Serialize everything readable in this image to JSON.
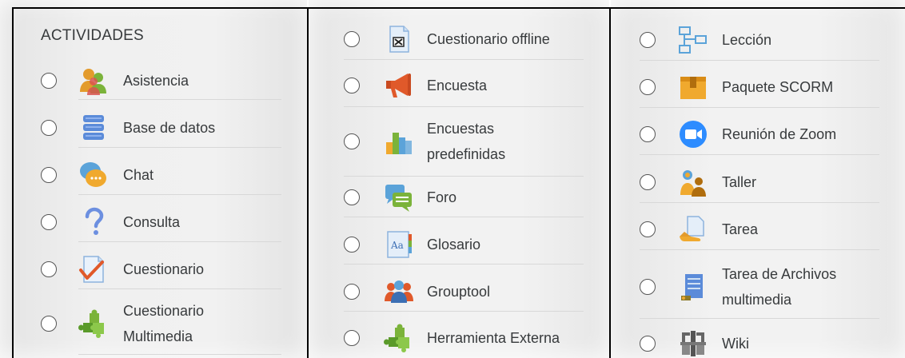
{
  "heading": "ACTIVIDADES",
  "columns": [
    {
      "items": [
        {
          "label": "Asistencia",
          "icon": "attendance-icon"
        },
        {
          "label": "Base de datos",
          "icon": "database-icon"
        },
        {
          "label": "Chat",
          "icon": "chat-icon"
        },
        {
          "label": "Consulta",
          "icon": "question-icon"
        },
        {
          "label": "Cuestionario",
          "icon": "quiz-icon"
        },
        {
          "label": "Cuestionario\nMultimedia",
          "icon": "puzzle-icon"
        }
      ]
    },
    {
      "items": [
        {
          "label": "Cuestionario offline",
          "icon": "offline-quiz-icon"
        },
        {
          "label": "Encuesta",
          "icon": "megaphone-icon"
        },
        {
          "label": "Encuestas\npredefinidas",
          "icon": "bar-chart-icon"
        },
        {
          "label": "Foro",
          "icon": "forum-icon"
        },
        {
          "label": "Glosario",
          "icon": "glossary-icon"
        },
        {
          "label": "Grouptool",
          "icon": "group-icon"
        },
        {
          "label": "Herramienta Externa",
          "icon": "puzzle-icon"
        }
      ]
    },
    {
      "items": [
        {
          "label": "Lección",
          "icon": "lesson-icon"
        },
        {
          "label": "Paquete SCORM",
          "icon": "package-icon"
        },
        {
          "label": "Reunión de Zoom",
          "icon": "zoom-icon"
        },
        {
          "label": "Taller",
          "icon": "workshop-icon"
        },
        {
          "label": "Tarea",
          "icon": "assignment-icon"
        },
        {
          "label": "Tarea de Archivos\nmultimedia",
          "icon": "multimedia-assignment-icon"
        },
        {
          "label": "Wiki",
          "icon": "wiki-icon"
        }
      ]
    }
  ]
}
